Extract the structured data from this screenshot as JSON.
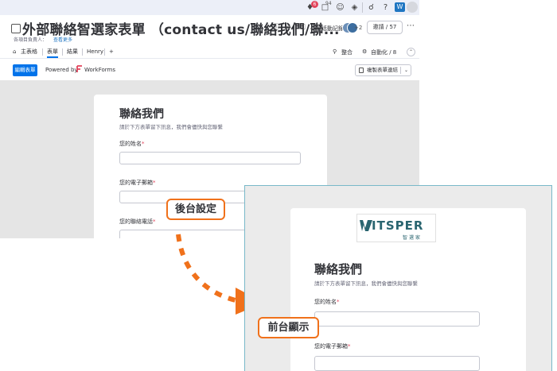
{
  "topbar": {
    "notification_badge": "6",
    "inbox_badge": "94",
    "app_logo": "W"
  },
  "board": {
    "title": "外部聯絡智選家表單 （contact us/聯絡我們/聯...",
    "owner_label": "各項目負責人：",
    "see_more": "查看更多",
    "activity": "活動記錄",
    "avatars_more": "+2",
    "invite": "邀請 / 57"
  },
  "tabs": [
    {
      "label": "主表格"
    },
    {
      "label": "表單"
    },
    {
      "label": "結果"
    },
    {
      "label": "Henry"
    },
    {
      "label": "+"
    }
  ],
  "right_tabs": {
    "integrate": "整合",
    "automate": "自動化 / 8"
  },
  "toolbar": {
    "edit_form": "編輯表單",
    "powered_by": "Powered by",
    "brand": "WorkForms",
    "copy_link": "複製表單連結"
  },
  "admin_form": {
    "title": "聯絡我們",
    "description": "請於下方表單留下訊息，我們會儘快與您聯繫",
    "fields": [
      {
        "label": "您的姓名",
        "required": "*"
      },
      {
        "label": "您的電子郵箱",
        "required": "*"
      },
      {
        "label": "您的聯絡電話",
        "required": "*"
      }
    ]
  },
  "front_form": {
    "logo_text": "ITSPER",
    "logo_sub": "智選家",
    "title": "聯絡我們",
    "description": "請於下方表單留下訊息，我們會儘快與您聯繫",
    "fields": [
      {
        "label": "您的姓名",
        "required": "*"
      },
      {
        "label": "您的電子郵箱",
        "required": "*"
      }
    ]
  },
  "callouts": {
    "backend": "後台設定",
    "frontend": "前台顯示"
  },
  "colors": {
    "primary": "#0073ea",
    "accent_orange": "#f0711b",
    "front_border": "#79b9c9",
    "logo_teal": "#2a6570"
  }
}
